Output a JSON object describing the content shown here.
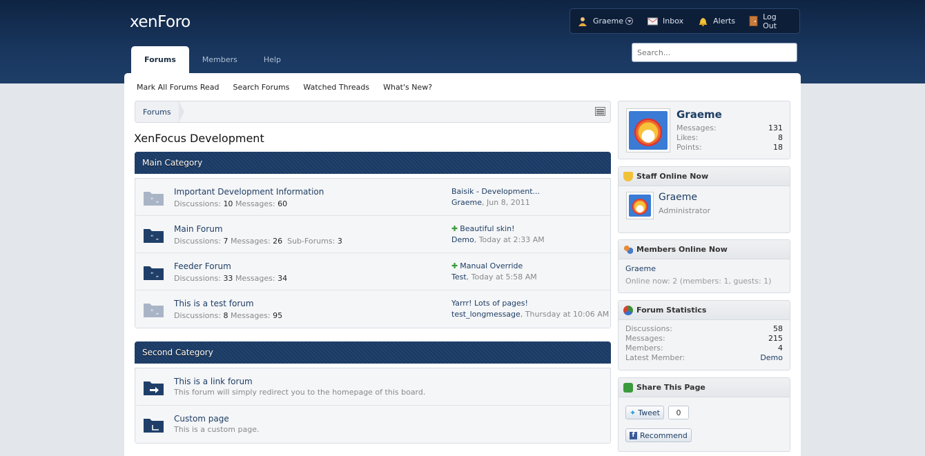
{
  "header": {
    "logo": "xenForo",
    "user": {
      "name": "Graeme"
    },
    "inbox_label": "Inbox",
    "alerts_label": "Alerts",
    "logout_label": "Log Out",
    "search_placeholder": "Search...",
    "tabs": [
      {
        "label": "Forums",
        "active": true
      },
      {
        "label": "Members",
        "active": false
      },
      {
        "label": "Help",
        "active": false
      }
    ]
  },
  "subnav": [
    "Mark All Forums Read",
    "Search Forums",
    "Watched Threads",
    "What's New?"
  ],
  "breadcrumb": {
    "item": "Forums"
  },
  "page_title": "XenFocus Development",
  "categories": [
    {
      "title": "Main Category",
      "forums": [
        {
          "title": "Important Development Information",
          "read": true,
          "stats": {
            "discussions_label": "Discussions:",
            "discussions": "10",
            "messages_label": "Messages:",
            "messages": "60"
          },
          "last_post": {
            "title": "Baisik - Development...",
            "new": false,
            "user": "Graeme",
            "time": "Jun 8, 2011"
          }
        },
        {
          "title": "Main Forum",
          "read": false,
          "stats": {
            "discussions_label": "Discussions:",
            "discussions": "7",
            "messages_label": "Messages:",
            "messages": "26",
            "subforums_label": "Sub-Forums:",
            "subforums": "3"
          },
          "last_post": {
            "title": "Beautiful skin!",
            "new": true,
            "user": "Demo",
            "time": "Today at 2:33 AM"
          }
        },
        {
          "title": "Feeder Forum",
          "read": false,
          "stats": {
            "discussions_label": "Discussions:",
            "discussions": "33",
            "messages_label": "Messages:",
            "messages": "34"
          },
          "last_post": {
            "title": "Manual Override",
            "new": true,
            "user": "Test",
            "time": "Today at 5:58 AM"
          }
        },
        {
          "title": "This is a test forum",
          "read": true,
          "stats": {
            "discussions_label": "Discussions:",
            "discussions": "8",
            "messages_label": "Messages:",
            "messages": "95"
          },
          "last_post": {
            "title": "Yarrr! Lots of pages!",
            "new": false,
            "user": "test_longmessage",
            "time": "Thursday at 10:06 AM"
          }
        }
      ]
    },
    {
      "title": "Second Category",
      "links": [
        {
          "title": "This is a link forum",
          "desc": "This forum will simply redirect you to the homepage of this board.",
          "icon": "link-forum-icon"
        },
        {
          "title": "Custom page",
          "desc": "This is a custom page.",
          "icon": "page-icon"
        }
      ]
    }
  ],
  "sidebar": {
    "visitor": {
      "name": "Graeme",
      "stats": [
        {
          "label": "Messages:",
          "value": "131"
        },
        {
          "label": "Likes:",
          "value": "8"
        },
        {
          "label": "Points:",
          "value": "18"
        }
      ]
    },
    "staff_online": {
      "title": "Staff Online Now",
      "member": {
        "name": "Graeme",
        "role": "Administrator"
      }
    },
    "members_online": {
      "title": "Members Online Now",
      "member": "Graeme",
      "footnote": "Online now: 2 (members: 1, guests: 1)"
    },
    "forum_stats": {
      "title": "Forum Statistics",
      "rows": [
        {
          "label": "Discussions:",
          "value": "58"
        },
        {
          "label": "Messages:",
          "value": "215"
        },
        {
          "label": "Members:",
          "value": "4"
        },
        {
          "label": "Latest Member:",
          "value": "Demo"
        }
      ]
    },
    "share": {
      "title": "Share This Page",
      "tweet_label": "Tweet",
      "tweet_count": "0",
      "recommend_label": "Recommend"
    }
  },
  "colors": {
    "header_bg": "#19365e",
    "category_bg": "#1f3f69",
    "link": "#1d3d63",
    "new_post": "#3a9a3a"
  }
}
